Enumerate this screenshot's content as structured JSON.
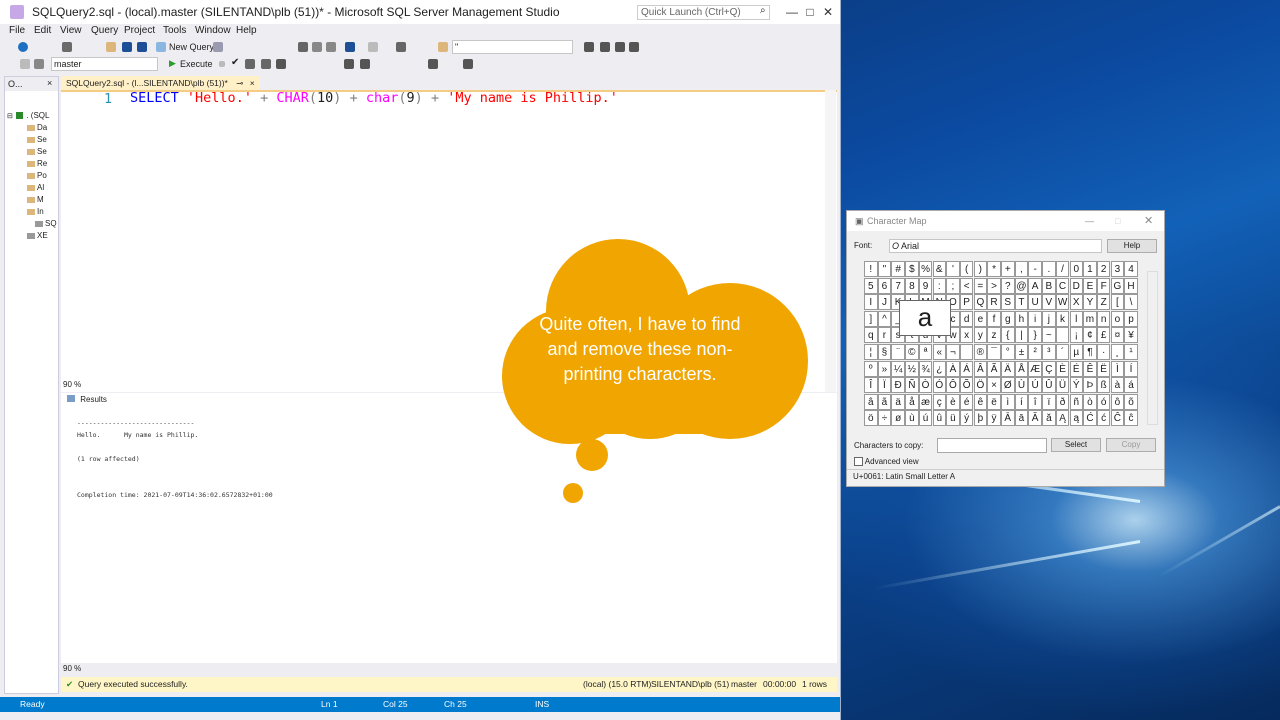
{
  "window": {
    "title": "SQLQuery2.sql - (local).master (SILENTAND\\plb (51))* - Microsoft SQL Server Management Studio",
    "quick_launch_placeholder": "Quick Launch (Ctrl+Q)",
    "minimize": "—",
    "maximize": "□",
    "close": "✕"
  },
  "menu": [
    "File",
    "Edit",
    "View",
    "Query",
    "Project",
    "Tools",
    "Window",
    "Help"
  ],
  "toolbar": {
    "new_query": "New Query",
    "database": "master",
    "execute": "Execute",
    "search_combo": "\""
  },
  "object_explorer": {
    "header": "O...",
    "root": ". (SQL",
    "items": [
      "Da",
      "Se",
      "Se",
      "Re",
      "Po",
      "Al",
      "M",
      "In",
      "SQ",
      "XE"
    ]
  },
  "editor": {
    "tab_label": "SQLQuery2.sql - (l...SILENTAND\\plb (51))*",
    "line_number": "1",
    "code_tokens": [
      {
        "t": "SELECT",
        "c": "kw"
      },
      {
        "t": " "
      },
      {
        "t": "'Hello.'",
        "c": "str"
      },
      {
        "t": " "
      },
      {
        "t": "+",
        "c": "op"
      },
      {
        "t": " "
      },
      {
        "t": "CHAR",
        "c": "fn"
      },
      {
        "t": "(",
        "c": "op"
      },
      {
        "t": "10"
      },
      {
        "t": ")",
        "c": "op"
      },
      {
        "t": " "
      },
      {
        "t": "+",
        "c": "op"
      },
      {
        "t": " "
      },
      {
        "t": "char",
        "c": "fn"
      },
      {
        "t": "(",
        "c": "op"
      },
      {
        "t": "9"
      },
      {
        "t": ")",
        "c": "op"
      },
      {
        "t": " "
      },
      {
        "t": "+",
        "c": "op"
      },
      {
        "t": " "
      },
      {
        "t": "'My name is Phillip.'",
        "c": "str"
      }
    ],
    "zoom": "90 %"
  },
  "results": {
    "tab_label": "Results",
    "lines": "------------------------------\nHello.      My name is Phillip.\n\n(1 row affected)\n\n\nCompletion time: 2021-07-09T14:36:02.6572832+01:00",
    "zoom": "90 %"
  },
  "query_status": {
    "message": "Query executed successfully.",
    "server": "(local) (15.0 RTM)",
    "user": "SILENTAND\\plb (51)",
    "db": "master",
    "time": "00:00:00",
    "rows": "1 rows"
  },
  "status_bar": {
    "state": "Ready",
    "ln": "Ln 1",
    "col": "Col 25",
    "ch": "Ch 25",
    "mode": "INS"
  },
  "charmap": {
    "title": "Character Map",
    "font_label": "Font:",
    "font_value": "Arial",
    "help": "Help",
    "magnified": "a",
    "chars_to_copy_label": "Characters to copy:",
    "select": "Select",
    "copy": "Copy",
    "advanced": "Advanced view",
    "status": "U+0061: Latin Small Letter A",
    "rows": [
      [
        "!",
        "\"",
        "#",
        "$",
        "%",
        "&",
        "'",
        "(",
        ")",
        "*",
        "+",
        ",",
        "-",
        ".",
        "/",
        "0",
        "1",
        "2",
        "3",
        "4"
      ],
      [
        "5",
        "6",
        "7",
        "8",
        "9",
        ":",
        ";",
        "<",
        "=",
        ">",
        "?",
        "@",
        "A",
        "B",
        "C",
        "D",
        "E",
        "F",
        "G",
        "H"
      ],
      [
        "I",
        "J",
        "K",
        "L",
        "M",
        "N",
        "O",
        "P",
        "Q",
        "R",
        "S",
        "T",
        "U",
        "V",
        "W",
        "X",
        "Y",
        "Z",
        "[",
        "\\"
      ],
      [
        "]",
        "^",
        "_",
        "`",
        "a",
        "b",
        "c",
        "d",
        "e",
        "f",
        "g",
        "h",
        "i",
        "j",
        "k",
        "l",
        "m",
        "n",
        "o",
        "p"
      ],
      [
        "q",
        "r",
        "s",
        "t",
        "u",
        "v",
        "w",
        "x",
        "y",
        "z",
        "{",
        "|",
        "}",
        "~",
        " ",
        "¡",
        "¢",
        "£",
        "¤",
        "¥"
      ],
      [
        "¦",
        "§",
        "¨",
        "©",
        "ª",
        "«",
        "¬",
        "­",
        "®",
        "¯",
        "°",
        "±",
        "²",
        "³",
        "´",
        "µ",
        "¶",
        "·",
        "¸",
        "¹"
      ],
      [
        "º",
        "»",
        "¼",
        "½",
        "¾",
        "¿",
        "À",
        "Á",
        "Â",
        "Ã",
        "Ä",
        "Å",
        "Æ",
        "Ç",
        "È",
        "É",
        "Ê",
        "Ë",
        "Ì",
        "Í"
      ],
      [
        "Î",
        "Ï",
        "Ð",
        "Ñ",
        "Ò",
        "Ó",
        "Ô",
        "Õ",
        "Ö",
        "×",
        "Ø",
        "Ù",
        "Ú",
        "Û",
        "Ü",
        "Ý",
        "Þ",
        "ß",
        "à",
        "á"
      ],
      [
        "â",
        "ã",
        "ä",
        "å",
        "æ",
        "ç",
        "è",
        "é",
        "ê",
        "ë",
        "ì",
        "í",
        "î",
        "ï",
        "ð",
        "ñ",
        "ò",
        "ó",
        "ô",
        "õ"
      ],
      [
        "ö",
        "÷",
        "ø",
        "ù",
        "ú",
        "û",
        "ü",
        "ý",
        "þ",
        "ÿ",
        "Ā",
        "ā",
        "Ă",
        "ă",
        "Ą",
        "ą",
        "Ć",
        "ć",
        "Ĉ",
        "ĉ"
      ]
    ]
  },
  "bubble": {
    "text": "Quite often, I have to find and remove these non-printing characters.",
    "color": "#f0a500"
  }
}
